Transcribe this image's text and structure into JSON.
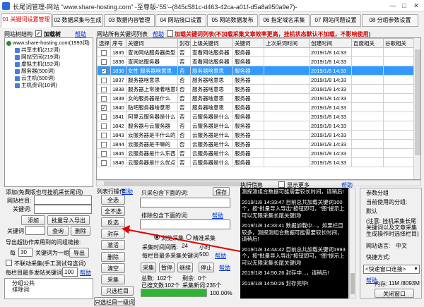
{
  "window": {
    "title": "长尾词管理-网站 \"www.share-hosting.com\" -至尊版-'55'--(845c581c-d463-42ca-a01f-d5a8a950a9e7)-",
    "min": "—",
    "max": "□",
    "close": "✕"
  },
  "tabs": [
    "01 关键词设置管理",
    "02 数据采集与生成",
    "03 数据内容管理",
    "04 网站接口设置",
    "05 网站数据发布",
    "06 指定域名采集",
    "07 网站问题设置",
    "08 分组参数设置"
  ],
  "left": {
    "tree_label": "网站树结构",
    "load_tree_label": "加载树",
    "help": "帮助",
    "tree": [
      {
        "text": "www.share-hosting.com(1993词)",
        "level": 0
      },
      {
        "text": "共享主机(212词)",
        "level": 1
      },
      {
        "text": "网站空间(219词)",
        "level": 1
      },
      {
        "text": "虚拟主机(152词)",
        "level": 1
      },
      {
        "text": "服务器(500词)",
        "level": 1
      },
      {
        "text": "云主机(500词)",
        "level": 1
      },
      {
        "text": "主机资讯(10词)",
        "level": 1
      }
    ],
    "add_title": "添加(免費版也可挂机采长尾词)",
    "site_column_label": "网站栏目:",
    "keyword_label": "关键词:",
    "add_btn": "添加",
    "batch_import_btn": "批量导入导出",
    "kw_label2": "关键词",
    "query_btn": "查询",
    "delete_btn": "删除",
    "export_title": "导出超协作库用到的问组链接:",
    "each_label": "每",
    "each_value": "30",
    "kw_group_label": "关键词为一组",
    "export_btn": "导出",
    "no_dynamic_label": "不联动采集(手工测试勾选词)",
    "max_per_column_label": "每栏目最多发帖关键词",
    "max_per_column_value": "100",
    "help2": "帮助",
    "group_keyword_label": "分组公共\n排除词:"
  },
  "grid": {
    "title": "网站所有关键词列表",
    "help": "帮助",
    "auto_load_label": "加载关键词列表(不加载采集文章效率更高，挂机状态默认不加载，不影响使用)",
    "columns": [
      "选择",
      "序号",
      "关键词",
      "封存",
      "上级关键词",
      "关键词",
      "上次采词时间",
      "创建时间",
      "百度相关",
      "谷歌相关"
    ],
    "rows": [
      {
        "checked": false,
        "no": "1835",
        "kw": "查询网站服务器类型",
        "seal": "否",
        "parent": "查看网站服务器",
        "kw2": "服务器",
        "last": "",
        "created": "2019/1/8 14:33",
        "sel": false
      },
      {
        "checked": false,
        "no": "1836",
        "kw": "查网站服务器",
        "seal": "否",
        "parent": "查看网站服务器",
        "kw2": "服务器",
        "last": "",
        "created": "2019/1/8 14:33",
        "sel": false
      },
      {
        "checked": true,
        "no": "1836",
        "kw": "女性 服务器啥意思",
        "seal": "否",
        "parent": "服务器啥意思",
        "kw2": "服务器",
        "last": "",
        "created": "2019/1/8 14:33",
        "sel": true
      },
      {
        "checked": false,
        "no": "1837",
        "kw": "服务器啥意思",
        "seal": "否",
        "parent": "服务器啥意思",
        "kw2": "服务器",
        "last": "",
        "created": "2019/1/8 14:33",
        "sel": false
      },
      {
        "checked": false,
        "no": "1838",
        "kw": "服务器上常接着啥意思",
        "seal": "否",
        "parent": "服务器啥意思",
        "kw2": "服务器",
        "last": "",
        "created": "2019/1/8 14:33",
        "sel": false
      },
      {
        "checked": false,
        "no": "1839",
        "kw": "女的服务器是什么",
        "seal": "否",
        "parent": "服务器啥意思",
        "kw2": "服务器",
        "last": "",
        "created": "2019/1/8 14:33",
        "sel": false
      },
      {
        "checked": true,
        "no": "1840",
        "kw": "贴吧服务器啥意思",
        "seal": "否",
        "parent": "服务器啥意思",
        "kw2": "服务器",
        "last": "",
        "created": "2019/1/8 14:33",
        "sel": false
      },
      {
        "checked": false,
        "no": "1841",
        "kw": "阿里云服务器是什么",
        "seal": "否",
        "parent": "云服务器是什么",
        "kw2": "服务器",
        "last": "",
        "created": "2019/1/8 14:33",
        "sel": false
      },
      {
        "checked": false,
        "no": "1842",
        "kw": "服务器与云服务器",
        "seal": "否",
        "parent": "云服务器是什么",
        "kw2": "服务器",
        "last": "",
        "created": "2019/1/8 14:33",
        "sel": false
      },
      {
        "checked": false,
        "no": "1843",
        "kw": "云服务器是干什么的",
        "seal": "否",
        "parent": "云服务器是什么",
        "kw2": "服务器",
        "last": "",
        "created": "2019/1/8 14:33",
        "sel": false
      },
      {
        "checked": false,
        "no": "1844",
        "kw": "云服务器是干嘛的",
        "seal": "否",
        "parent": "云服务器是什么",
        "kw2": "服务器",
        "last": "",
        "created": "2019/1/8 14:33",
        "sel": false
      },
      {
        "checked": false,
        "no": "1845",
        "kw": "云服务器是什么东西",
        "seal": "否",
        "parent": "云服务器是什么",
        "kw2": "服务器",
        "last": "",
        "created": "2019/1/8 14:33",
        "sel": false
      },
      {
        "checked": false,
        "no": "1846",
        "kw": "云服务器是什么优点",
        "seal": "否",
        "parent": "云服务器是什么",
        "kw2": "服务器",
        "last": "",
        "created": "2019/1/8 14:33",
        "sel": false
      }
    ]
  },
  "ops": {
    "list_op_label": "列表行操作",
    "help": "帮助",
    "select_all": "全选",
    "deselect_all": "全不选",
    "invert": "反选",
    "seal": "封存",
    "activate": "激活",
    "delete": "删除",
    "clear": "清空",
    "collect": "采集",
    "column_only": "只选栏目",
    "column_level1": "只选栏目一级词"
  },
  "mid": {
    "title_include_label": "只采包含下面的词:",
    "save_btn": "保存",
    "exclude_label": "排除包含下面的词:",
    "help": "帮助",
    "radio1": "浏览采集",
    "radio2": "精准采集",
    "interval_label": "采集时间间隔:",
    "interval_value": "24",
    "interval_unit": "小时",
    "per_column_label": "每栏目最多采集关键词",
    "per_column_value": "500",
    "help2": "帮助",
    "btn_collect": "采集",
    "btn_pause": "暂停",
    "btn_continue": "继续",
    "btn_stop": "停止",
    "btn_help": "帮助",
    "stat1_label": "总数:",
    "stat1_value": "102个",
    "stat2_label": "剩余:",
    "stat2_value": "0个",
    "stat3_label": "已搜文数:",
    "stat3_value": "102个",
    "stat4_label": "采集新词:",
    "stat4_value": "235个",
    "progress_label": "100.00%",
    "progress": 1.0
  },
  "log": {
    "title": "执行信息",
    "show_more_label": "显示更多",
    "help": "帮助",
    "lines": [
      "测探测组合数据可能需要较长时间，请稍后!",
      "2019/1/8 14:33:47  目前总共加载关键词100个，按\"批量导入导出\"按钮即可，\"图\"提示上可以无限采集长尾关键词!",
      "2019/1/8 14:33:41  数据加载中...，如果栏目较多，测探测组合数据可能需要较长时间，请稍后!",
      "2019/1/8 14:44:42  目前总共加载关键词1993个，按\"批量导入导出\"按钮即可，\"图\"提示上可以无限采集长尾关键词!",
      "2019/1/8 14:50:26  封存中...，请稍后!",
      "2019/1/8 14:50:26  封存完毕!"
    ]
  },
  "right": {
    "param_group_label": "参数分组",
    "current_group_label": "当前使用的分组:",
    "current_group_value": "默认",
    "note": "(注意: 挂机采集长尾关键词以及文章采集生成操作时选择栏目)",
    "lang_label": "网站语言:",
    "lang_value": "中文",
    "fast_label": "快捷方式:",
    "fast_value": "<快速窗口连接>",
    "help": "帮助",
    "mem_label": "内存:",
    "mem_value": "11M /8093M",
    "close_btn": "关闭窗口"
  },
  "colors": {
    "accent_red": "#d00000",
    "select_blue": "#3399ff",
    "link_blue": "#0033cc",
    "progress_green": "#2fb52f"
  }
}
